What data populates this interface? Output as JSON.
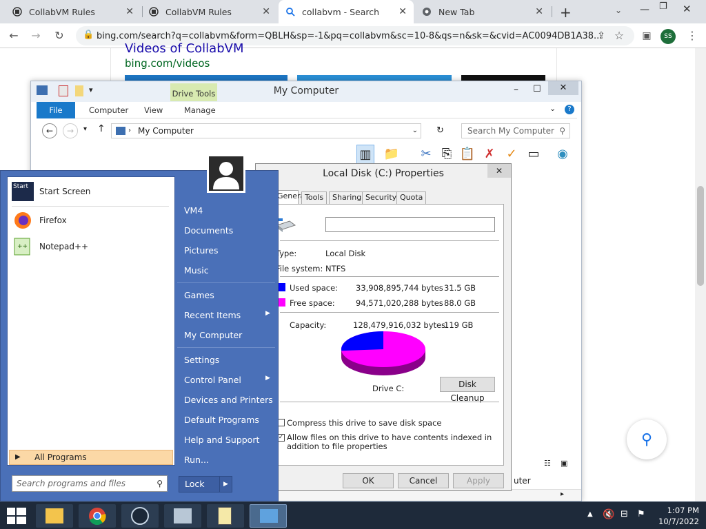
{
  "browser": {
    "tabs": [
      {
        "label": "CollabVM Rules"
      },
      {
        "label": "CollabVM Rules"
      },
      {
        "label": "collabvm - Search"
      },
      {
        "label": "New Tab"
      }
    ],
    "new_tab": "+",
    "url": "bing.com/search?q=collabvm&form=QBLH&sp=-1&pq=collabvm&sc=10-8&qs=n&sk=&cvid=AC0094DB1A38...",
    "profile": "SS"
  },
  "page": {
    "heading": "Videos of CollabVM",
    "link": "bing.com/videos"
  },
  "explorer": {
    "title": "My Computer",
    "drive_tools": "Drive Tools",
    "ribbon_tabs": [
      "File",
      "Computer",
      "View",
      "Manage"
    ],
    "address": "My Computer",
    "search_placeholder": "Search My Computer",
    "status_fragment": "uter"
  },
  "props": {
    "title": "Local Disk (C:) Properties",
    "tabs": [
      "General",
      "Tools",
      "Sharing",
      "Security",
      "Quota"
    ],
    "name_value": "",
    "type_label": "Type:",
    "type_value": "Local Disk",
    "fs_label": "File system:",
    "fs_value": "NTFS",
    "used_label": "Used space:",
    "used_bytes": "33,908,895,744 bytes",
    "used_gb": "31.5 GB",
    "free_label": "Free space:",
    "free_bytes": "94,571,020,288 bytes",
    "free_gb": "88.0 GB",
    "capacity_label": "Capacity:",
    "capacity_bytes": "128,479,916,032 bytes",
    "capacity_gb": "119 GB",
    "drive_label": "Drive C:",
    "disk_cleanup": "Disk Cleanup",
    "compress_label": "Compress this drive to save disk space",
    "index_label": "Allow files on this drive to have contents indexed in addition to file properties",
    "ok": "OK",
    "cancel": "Cancel",
    "apply": "Apply",
    "used_fraction": 0.264,
    "colors": {
      "used": "#0000ff",
      "free": "#ff00ff"
    }
  },
  "start_menu": {
    "pinned": [
      {
        "label": "Start Screen"
      },
      {
        "label": "Firefox"
      },
      {
        "label": "Notepad++"
      }
    ],
    "all_programs": "All Programs",
    "search_placeholder": "Search programs and files",
    "right_items": [
      "VM4",
      "Documents",
      "Pictures",
      "Music",
      "Games",
      "Recent Items",
      "My Computer",
      "Settings",
      "Control Panel",
      "Devices and Printers",
      "Default Programs",
      "Help and Support",
      "Run..."
    ],
    "lock": "Lock",
    "start_icon_text": "Start"
  },
  "taskbar": {
    "time": "1:07 PM",
    "date": "10/7/2022"
  }
}
